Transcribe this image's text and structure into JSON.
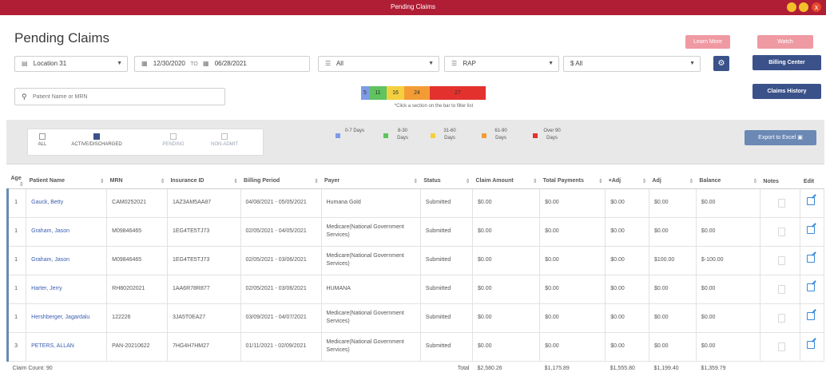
{
  "window": {
    "title": "Pending Claims",
    "close_glyph": "x"
  },
  "header": {
    "title": "Pending Claims",
    "learn_more": "Learn More",
    "watch": "Watch"
  },
  "actions": {
    "billing_center": "Billing Center",
    "claims_history": "Claims History",
    "settings_icon": "gear-icon"
  },
  "filters": {
    "location": "Location 31",
    "date_from": "12/30/2020",
    "date_to_label": "TO",
    "date_to": "06/28/2021",
    "filter1": "All",
    "filter2": "RAP",
    "amount": "$ All"
  },
  "search": {
    "placeholder": "Patient Name or MRN"
  },
  "age_bar": {
    "segments": [
      {
        "label": "5",
        "color": "#7d9be6"
      },
      {
        "label": "11",
        "color": "#5fc45f"
      },
      {
        "label": "16",
        "color": "#f4d03f"
      },
      {
        "label": "24",
        "color": "#f39c35"
      },
      {
        "label": "27",
        "color": "#e3312e"
      }
    ],
    "hint": "*Click a section on the bar to filter list"
  },
  "status_filters": [
    {
      "label": "ALL",
      "checked": false,
      "dim": false
    },
    {
      "label": "ACTIVE/DISCHARGED",
      "checked": true,
      "dim": false
    },
    {
      "label": "PENDING",
      "checked": false,
      "dim": true
    },
    {
      "label": "NON-ADMIT",
      "checked": false,
      "dim": true
    }
  ],
  "age_legend": [
    {
      "label": "0-7 Days",
      "color": "#7d9be6"
    },
    {
      "label": "8-30 Days",
      "color": "#5fc45f"
    },
    {
      "label": "31-60 Days",
      "color": "#f4d03f"
    },
    {
      "label": "61-90 Days",
      "color": "#f39c35"
    },
    {
      "label": "Over 90 Days",
      "color": "#e3312e"
    }
  ],
  "export": {
    "label": "Export to Excel"
  },
  "table": {
    "columns": [
      "Age",
      "Patient Name",
      "MRN",
      "Insurance ID",
      "Billing Period",
      "Payer",
      "Status",
      "Claim Amount",
      "Total Payments",
      "+Adj",
      "Adj",
      "Balance",
      "Notes",
      "Edit"
    ],
    "rows": [
      {
        "age": "1",
        "name": "Gauck, Betty",
        "mrn": "CAM0252021",
        "ins": "1AZ3AM5AA87",
        "period": "04/08/2021 - 05/05/2021",
        "payer": "Humana Gold",
        "status": "Submitted",
        "claim": "$0.00",
        "payments": "$0.00",
        "padj": "$0.00",
        "adj": "$0.00",
        "balance": "$0.00"
      },
      {
        "age": "1",
        "name": "Graham, Jason",
        "mrn": "M09846465",
        "ins": "1EG4TE5TJ73",
        "period": "02/05/2021 - 04/05/2021",
        "payer": "Medicare(National Government Services)",
        "status": "Submitted",
        "claim": "$0.00",
        "payments": "$0.00",
        "padj": "$0.00",
        "adj": "$0.00",
        "balance": "$0.00"
      },
      {
        "age": "1",
        "name": "Graham, Jason",
        "mrn": "M09846465",
        "ins": "1EG4TE5TJ73",
        "period": "02/05/2021 - 03/06/2021",
        "payer": "Medicare(National Government Services)",
        "status": "Submitted",
        "claim": "$0.00",
        "payments": "$0.00",
        "padj": "$0.00",
        "adj": "$100.00",
        "balance": "$-100.00"
      },
      {
        "age": "1",
        "name": "Harter, Jerry",
        "mrn": "RH80202021",
        "ins": "1AA6R78R877",
        "period": "02/05/2021 - 03/06/2021",
        "payer": "HUMANA",
        "status": "Submitted",
        "claim": "$0.00",
        "payments": "$0.00",
        "padj": "$0.00",
        "adj": "$0.00",
        "balance": "$0.00"
      },
      {
        "age": "1",
        "name": "Hershberger, Jagardalu",
        "mrn": "122226",
        "ins": "3JA5T0EA27",
        "period": "03/09/2021 - 04/07/2021",
        "payer": "Medicare(National Government Services)",
        "status": "Submitted",
        "claim": "$0.00",
        "payments": "$0.00",
        "padj": "$0.00",
        "adj": "$0.00",
        "balance": "$0.00"
      },
      {
        "age": "3",
        "name": "PETERS, ALLAN",
        "mrn": "PAN-20210622",
        "ins": "7HG4H7HM27",
        "period": "01/11/2021 - 02/09/2021",
        "payer": "Medicare(National Government Services)",
        "status": "Submitted",
        "claim": "$0.00",
        "payments": "$0.00",
        "padj": "$0.00",
        "adj": "$0.00",
        "balance": "$0.00"
      }
    ],
    "footer": {
      "claim_count": "Claim Count: 90",
      "total_label": "Total",
      "claim": "$2,580.26",
      "payments": "$1,175.89",
      "padj": "$1,555.80",
      "adj": "$1,199.40",
      "balance": "$1,359.79"
    }
  }
}
